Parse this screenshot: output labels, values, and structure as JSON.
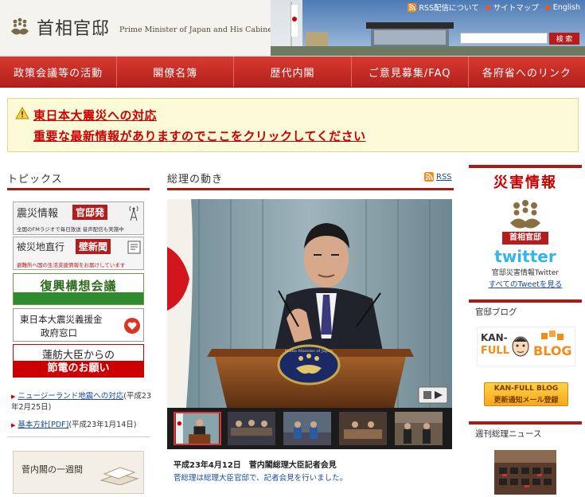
{
  "header": {
    "logo_jp": "首相官邸",
    "logo_en": "Prime Minister of Japan and His Cabinet",
    "links": [
      "RSS配信について",
      "サイトマップ",
      "English"
    ],
    "search_button": "検 索",
    "search_placeholder": ""
  },
  "nav": [
    "政策会議等の活動",
    "閣僚名簿",
    "歴代内閣",
    "ご意見募集/FAQ",
    "各府省へのリンク"
  ],
  "alert": {
    "line1": "東日本大震災への対応",
    "line2": "重要な最新情報がありますのでここをクリックしてください"
  },
  "topics": {
    "title": "トピックス",
    "banners": {
      "b1_main": "震災情報",
      "b1_tag": "官邸発",
      "b1_sub": "全国のFMラジオで毎日放送 音声配信も実施中",
      "b2_main": "被災地直行",
      "b2_tag": "壁新聞",
      "b2_sub": "避難所へ国の生活支援情報をお届けしています",
      "b3": "復興構想会議",
      "b4_l1": "東日本大震災義援金",
      "b4_l2": "政府窓口",
      "b5_l1": "蓮舫大臣からの",
      "b5_l2": "節電のお願い"
    },
    "items": [
      {
        "link": "ニュージーランド地震への対応",
        "date": "(平成23年2月25日)"
      },
      {
        "link": "基本方針[PDF]",
        "date": "(平成23年1月14日)"
      }
    ],
    "weekly": "菅内閣の一週間"
  },
  "main": {
    "title": "総理の動き",
    "rss": "RSS",
    "podium_text": "Prime Minister of Japan",
    "caption_title": "平成23年4月12日　菅内閣総理大臣記者会見",
    "caption_desc": "菅総理は総理大臣官邸で、記者会見を行いました。"
  },
  "right": {
    "disaster_title": "災害情報",
    "kantei_label": "首相官邸",
    "twitter": "twitter",
    "twitter_sub": "官邸災害情報Twitter",
    "twitter_link": "すべてのTweetを見る",
    "blog_title": "官邸ブログ",
    "blog_logo_top": "KAN-",
    "blog_logo_full": "FULL",
    "blog_logo_blog": "BLOG",
    "blog_banner_top": "KAN-FULL BLOG",
    "blog_banner_sub": "更新通知メール登録",
    "news_title": "週刊総理ニュース"
  },
  "colors": {
    "brand_red": "#b71c1c",
    "link_blue": "#1a4aa0",
    "alert_bg": "#fdfad8"
  }
}
